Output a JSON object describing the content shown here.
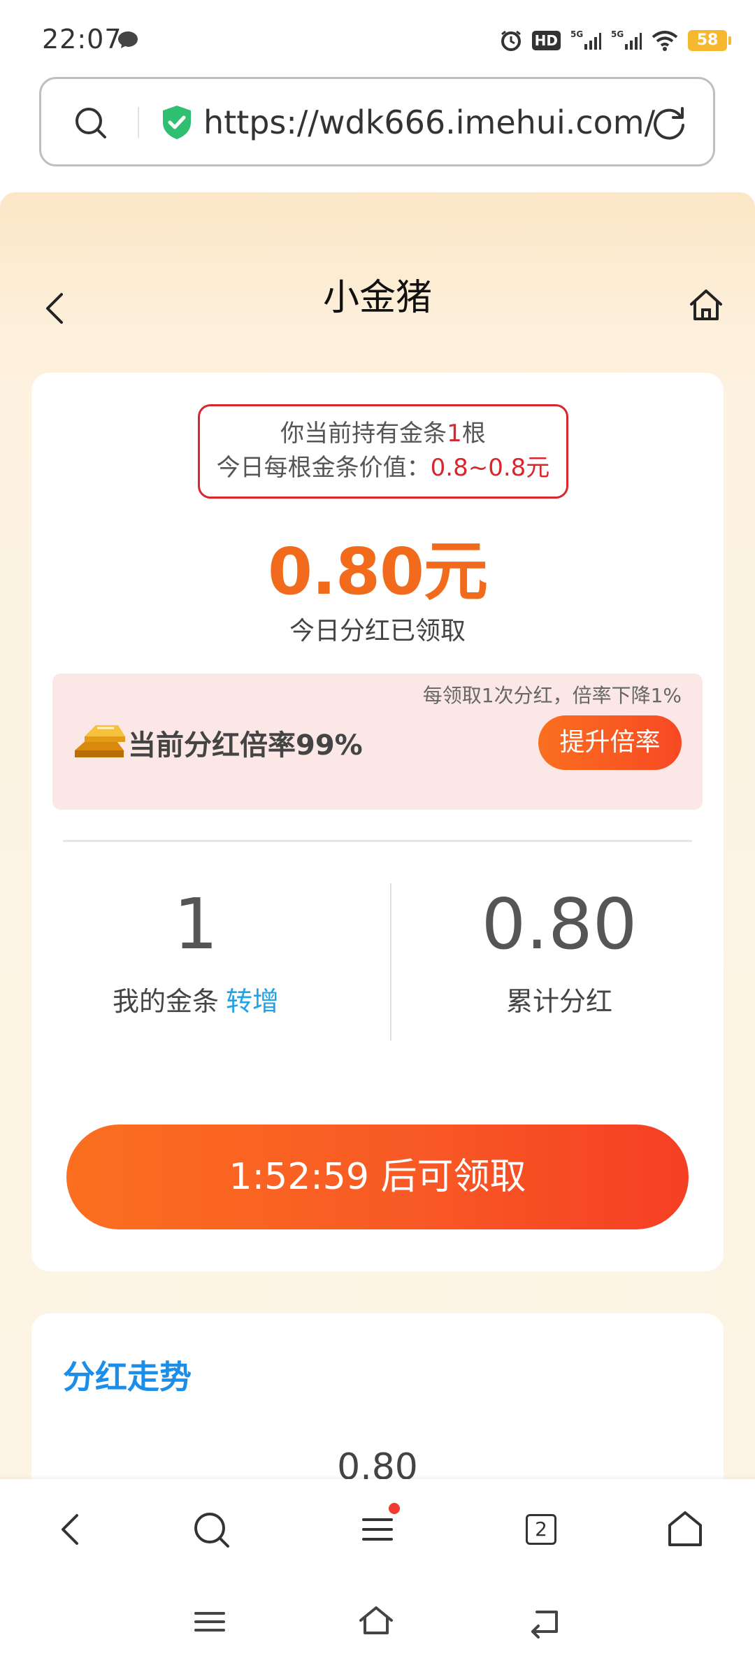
{
  "status_bar": {
    "time": "22:07",
    "hd_label": "HD",
    "battery": "58"
  },
  "url_bar": {
    "url": "https://wdk666.imehui.com/"
  },
  "page": {
    "title": "小金猪",
    "holding_prefix": "你当前持有金条",
    "holding_count": "1",
    "holding_suffix": "根",
    "value_prefix": "今日每根金条价值：",
    "value_range": "0.8~0.8元",
    "today_amount": "0.80元",
    "claimed_text": "今日分红已领取",
    "rate_note": "每领取1次分红，倍率下降1%",
    "rate_text": "当前分红倍率99%",
    "rate_button": "提升倍率",
    "my_gold_value": "1",
    "my_gold_label": "我的金条",
    "transfer_link": "转增",
    "total_dividend_value": "0.80",
    "total_dividend_label": "累计分红",
    "claim_button": "1:52:59 后可领取",
    "trend_title": "分红走势",
    "trend_peek_value": "0.80"
  },
  "browser_bar": {
    "tab_count": "2"
  },
  "colors": {
    "accent_orange": "#f26b1d",
    "alert_red": "#d9262c",
    "link_blue": "#21a3e8",
    "trend_blue": "#1a8ee8"
  }
}
